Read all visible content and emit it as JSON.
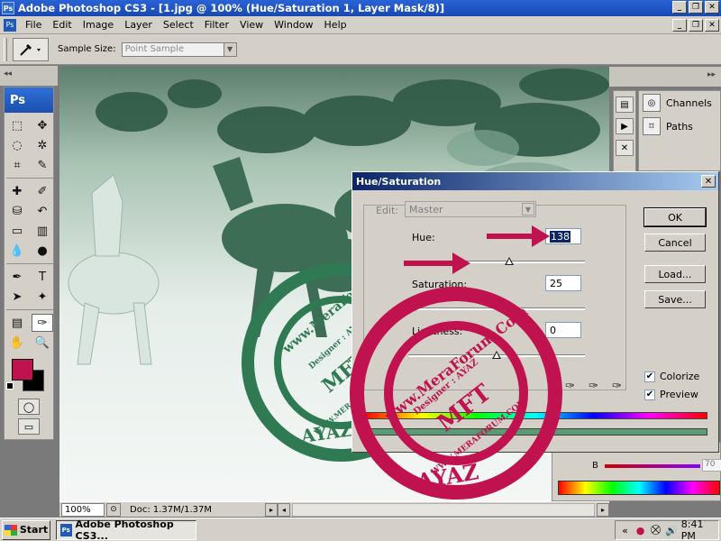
{
  "window": {
    "title": "Adobe Photoshop CS3 - [1.jpg @ 100% (Hue/Saturation 1, Layer Mask/8)]",
    "min_label": "_",
    "max_label": "❐",
    "close_label": "✕"
  },
  "menubar": {
    "items": [
      "File",
      "Edit",
      "Image",
      "Layer",
      "Select",
      "Filter",
      "View",
      "Window",
      "Help"
    ]
  },
  "options": {
    "sample_size_label": "Sample Size:",
    "sample_size_value": "Point Sample"
  },
  "tools": {
    "logo": "Ps"
  },
  "statusbar": {
    "zoom": "100%",
    "doc": "Doc: 1.37M/1.37M"
  },
  "panels": {
    "channels_label": "Channels",
    "paths_label": "Paths",
    "b_label": "B",
    "b_value": "70"
  },
  "dialog": {
    "title": "Hue/Saturation",
    "edit_label": "Edit:",
    "edit_value": "Master",
    "hue_label": "Hue:",
    "hue_value": "138",
    "hue_position": 0.57,
    "saturation_label": "Saturation:",
    "saturation_value": "25",
    "saturation_position": 0.56,
    "lightness_label": "Lightness:",
    "lightness_value": "0",
    "lightness_position": 0.5,
    "ok_label": "OK",
    "cancel_label": "Cancel",
    "load_label": "Load...",
    "save_label": "Save...",
    "colorize_label": "Colorize",
    "colorize_checked": true,
    "preview_label": "Preview",
    "preview_checked": true
  },
  "watermark": {
    "green_site": "www.MeraForum.Com",
    "green_designer": "Designer : AYAZ",
    "green_center": "MFT",
    "green_site_small": "WWW.MERAFORUM.COM",
    "green_name": "AYAZ",
    "red_site": "www.MeraForum.Com",
    "red_designer": "Designer : AYAZ",
    "red_center": "MFT",
    "red_site_small": "WWW.MERAFORUM.COM",
    "red_name": "AYAZ"
  },
  "taskbar": {
    "start_label": "Start",
    "task_label": "Adobe Photoshop CS3...",
    "clock": "8:41 PM"
  },
  "colors": {
    "accent_red": "#c0124e",
    "stamp_green": "#2f7a52",
    "foreground_color": "#c0124e"
  }
}
